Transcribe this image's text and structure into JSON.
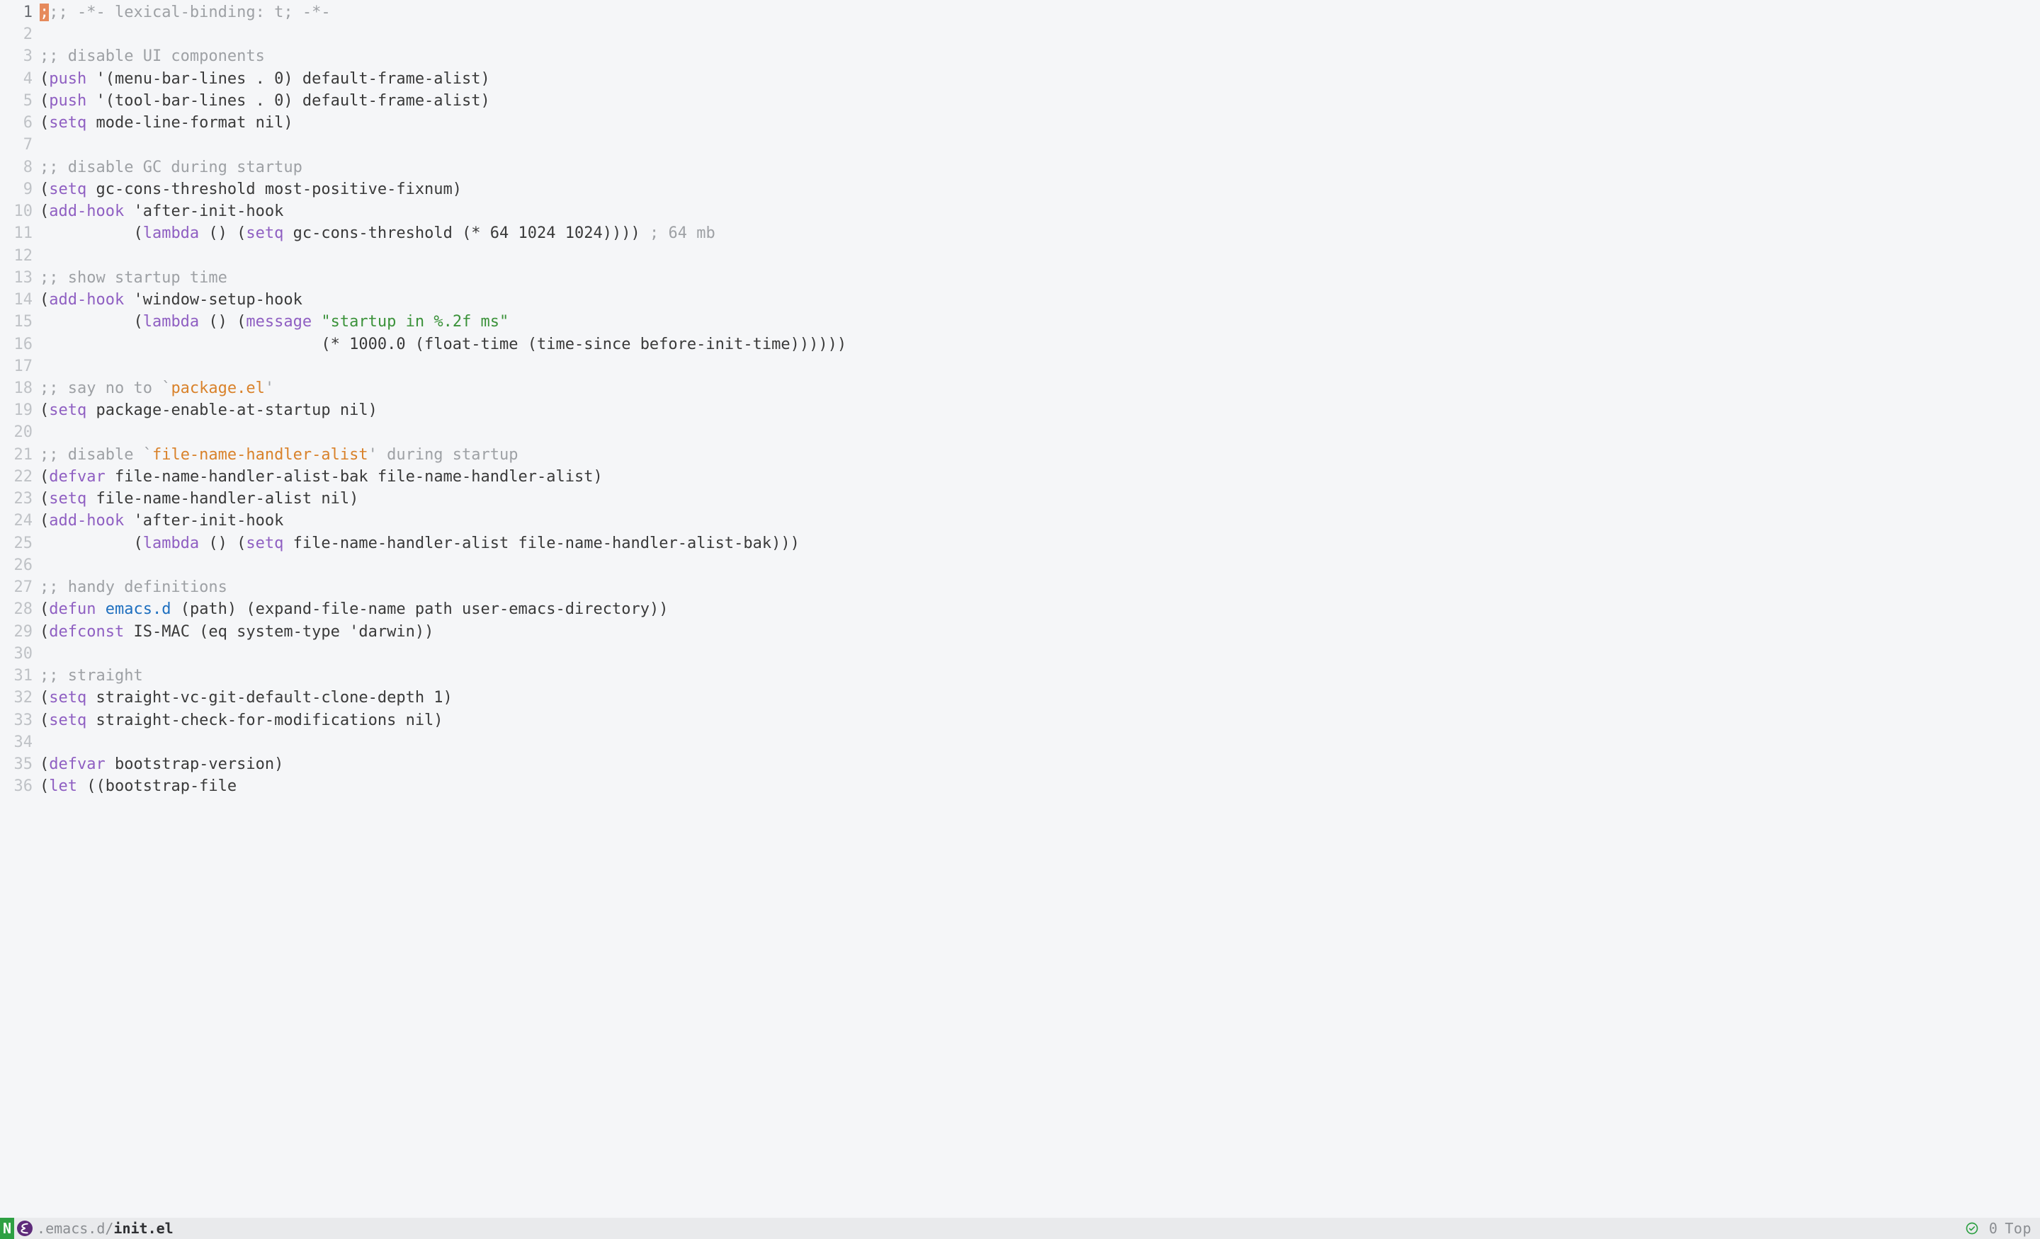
{
  "modeline": {
    "mode_badge": "N",
    "path_prefix": ".emacs.d/",
    "filename": "init.el",
    "line_col": "0",
    "position": "Top"
  },
  "current_line": 1,
  "lines": [
    {
      "n": 1,
      "tokens": [
        {
          "t": ";",
          "cls": "cursor"
        },
        {
          "t": ";; -*- lexical-binding: t; -*-",
          "cls": "cm"
        }
      ]
    },
    {
      "n": 2,
      "tokens": []
    },
    {
      "n": 3,
      "tokens": [
        {
          "t": ";; disable UI components",
          "cls": "cm"
        }
      ]
    },
    {
      "n": 4,
      "tokens": [
        {
          "t": "(",
          "cls": "paren"
        },
        {
          "t": "push",
          "cls": "kw"
        },
        {
          "t": " '(menu-bar-lines . 0) default-frame-alist)",
          "cls": "plain"
        }
      ]
    },
    {
      "n": 5,
      "tokens": [
        {
          "t": "(",
          "cls": "paren"
        },
        {
          "t": "push",
          "cls": "kw"
        },
        {
          "t": " '(tool-bar-lines . 0) default-frame-alist)",
          "cls": "plain"
        }
      ]
    },
    {
      "n": 6,
      "tokens": [
        {
          "t": "(",
          "cls": "paren"
        },
        {
          "t": "setq",
          "cls": "kw"
        },
        {
          "t": " mode-line-format nil)",
          "cls": "plain"
        }
      ]
    },
    {
      "n": 7,
      "tokens": []
    },
    {
      "n": 8,
      "tokens": [
        {
          "t": ";; disable GC during startup",
          "cls": "cm"
        }
      ]
    },
    {
      "n": 9,
      "tokens": [
        {
          "t": "(",
          "cls": "paren"
        },
        {
          "t": "setq",
          "cls": "kw"
        },
        {
          "t": " gc-cons-threshold most-positive-fixnum)",
          "cls": "plain"
        }
      ]
    },
    {
      "n": 10,
      "tokens": [
        {
          "t": "(",
          "cls": "paren"
        },
        {
          "t": "add-hook",
          "cls": "kw"
        },
        {
          "t": " 'after-init-hook",
          "cls": "plain"
        }
      ]
    },
    {
      "n": 11,
      "tokens": [
        {
          "t": "          (",
          "cls": "plain"
        },
        {
          "t": "lambda",
          "cls": "kw"
        },
        {
          "t": " () (",
          "cls": "plain"
        },
        {
          "t": "setq",
          "cls": "kw"
        },
        {
          "t": " gc-cons-threshold (* 64 1024 1024)))) ",
          "cls": "plain"
        },
        {
          "t": "; 64 mb",
          "cls": "cm"
        }
      ]
    },
    {
      "n": 12,
      "tokens": []
    },
    {
      "n": 13,
      "tokens": [
        {
          "t": ";; show startup time",
          "cls": "cm"
        }
      ]
    },
    {
      "n": 14,
      "tokens": [
        {
          "t": "(",
          "cls": "paren"
        },
        {
          "t": "add-hook",
          "cls": "kw"
        },
        {
          "t": " 'window-setup-hook",
          "cls": "plain"
        }
      ]
    },
    {
      "n": 15,
      "tokens": [
        {
          "t": "          (",
          "cls": "plain"
        },
        {
          "t": "lambda",
          "cls": "kw"
        },
        {
          "t": " () (",
          "cls": "plain"
        },
        {
          "t": "message",
          "cls": "kw"
        },
        {
          "t": " ",
          "cls": "plain"
        },
        {
          "t": "\"startup in %.2f ms\"",
          "cls": "str"
        }
      ]
    },
    {
      "n": 16,
      "tokens": [
        {
          "t": "                              (* 1000.0 (float-time (time-since before-init-time))))))",
          "cls": "plain"
        }
      ]
    },
    {
      "n": 17,
      "tokens": []
    },
    {
      "n": 18,
      "tokens": [
        {
          "t": ";; say no to `",
          "cls": "cm"
        },
        {
          "t": "package.el",
          "cls": "quoted"
        },
        {
          "t": "'",
          "cls": "cm"
        }
      ]
    },
    {
      "n": 19,
      "tokens": [
        {
          "t": "(",
          "cls": "paren"
        },
        {
          "t": "setq",
          "cls": "kw"
        },
        {
          "t": " package-enable-at-startup nil)",
          "cls": "plain"
        }
      ]
    },
    {
      "n": 20,
      "tokens": []
    },
    {
      "n": 21,
      "tokens": [
        {
          "t": ";; disable `",
          "cls": "cm"
        },
        {
          "t": "file-name-handler-alist",
          "cls": "quoted"
        },
        {
          "t": "' during startup",
          "cls": "cm"
        }
      ]
    },
    {
      "n": 22,
      "tokens": [
        {
          "t": "(",
          "cls": "paren"
        },
        {
          "t": "defvar",
          "cls": "kw"
        },
        {
          "t": " file-name-handler-alist-bak file-name-handler-alist)",
          "cls": "plain"
        }
      ]
    },
    {
      "n": 23,
      "tokens": [
        {
          "t": "(",
          "cls": "paren"
        },
        {
          "t": "setq",
          "cls": "kw"
        },
        {
          "t": " file-name-handler-alist nil)",
          "cls": "plain"
        }
      ]
    },
    {
      "n": 24,
      "tokens": [
        {
          "t": "(",
          "cls": "paren"
        },
        {
          "t": "add-hook",
          "cls": "kw"
        },
        {
          "t": " 'after-init-hook",
          "cls": "plain"
        }
      ]
    },
    {
      "n": 25,
      "tokens": [
        {
          "t": "          (",
          "cls": "plain"
        },
        {
          "t": "lambda",
          "cls": "kw"
        },
        {
          "t": " () (",
          "cls": "plain"
        },
        {
          "t": "setq",
          "cls": "kw"
        },
        {
          "t": " file-name-handler-alist file-name-handler-alist-bak)))",
          "cls": "plain"
        }
      ]
    },
    {
      "n": 26,
      "tokens": []
    },
    {
      "n": 27,
      "tokens": [
        {
          "t": ";; handy definitions",
          "cls": "cm"
        }
      ]
    },
    {
      "n": 28,
      "tokens": [
        {
          "t": "(",
          "cls": "paren"
        },
        {
          "t": "defun",
          "cls": "kw"
        },
        {
          "t": " ",
          "cls": "plain"
        },
        {
          "t": "emacs.d",
          "cls": "fn"
        },
        {
          "t": " (path) (expand-file-name path user-emacs-directory))",
          "cls": "plain"
        }
      ]
    },
    {
      "n": 29,
      "tokens": [
        {
          "t": "(",
          "cls": "paren"
        },
        {
          "t": "defconst",
          "cls": "kw"
        },
        {
          "t": " IS-MAC (eq system-type 'darwin))",
          "cls": "plain"
        }
      ]
    },
    {
      "n": 30,
      "tokens": []
    },
    {
      "n": 31,
      "tokens": [
        {
          "t": ";; straight",
          "cls": "cm"
        }
      ]
    },
    {
      "n": 32,
      "tokens": [
        {
          "t": "(",
          "cls": "paren"
        },
        {
          "t": "setq",
          "cls": "kw"
        },
        {
          "t": " straight-vc-git-default-clone-depth 1)",
          "cls": "plain"
        }
      ]
    },
    {
      "n": 33,
      "tokens": [
        {
          "t": "(",
          "cls": "paren"
        },
        {
          "t": "setq",
          "cls": "kw"
        },
        {
          "t": " straight-check-for-modifications nil)",
          "cls": "plain"
        }
      ]
    },
    {
      "n": 34,
      "tokens": []
    },
    {
      "n": 35,
      "tokens": [
        {
          "t": "(",
          "cls": "paren"
        },
        {
          "t": "defvar",
          "cls": "kw"
        },
        {
          "t": " bootstrap-version)",
          "cls": "plain"
        }
      ]
    },
    {
      "n": 36,
      "tokens": [
        {
          "t": "(",
          "cls": "paren"
        },
        {
          "t": "let",
          "cls": "kw"
        },
        {
          "t": " ((bootstrap-file",
          "cls": "plain"
        }
      ]
    }
  ]
}
